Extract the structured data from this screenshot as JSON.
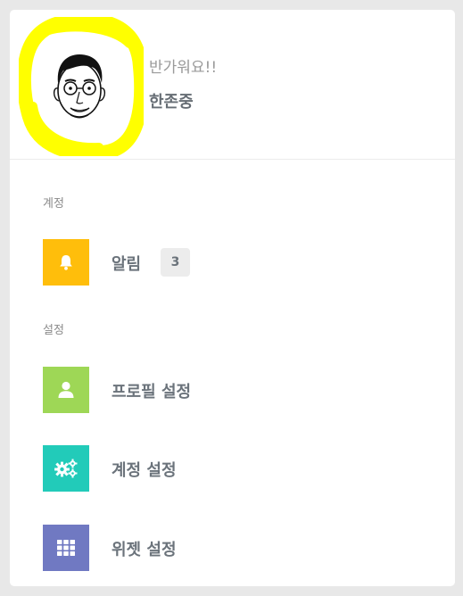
{
  "profile": {
    "greeting": "반가워요!!",
    "name": "한존중",
    "avatar_icon": "user-face-drawing-icon",
    "highlight_color": "#ffff00"
  },
  "sections": {
    "account": "계정",
    "settings": "설정"
  },
  "menu": {
    "notifications": {
      "label": "알림",
      "badge": "3",
      "icon": "bell-icon",
      "color": "#ffbe0b"
    },
    "profile_settings": {
      "label": "프로필 설정",
      "icon": "user-icon",
      "color": "#9ed756"
    },
    "account_settings": {
      "label": "계정 설정",
      "icon": "gears-icon",
      "color": "#22cbb9"
    },
    "widget_settings": {
      "label": "위젯 설정",
      "icon": "grid-icon",
      "color": "#7079c2"
    }
  }
}
